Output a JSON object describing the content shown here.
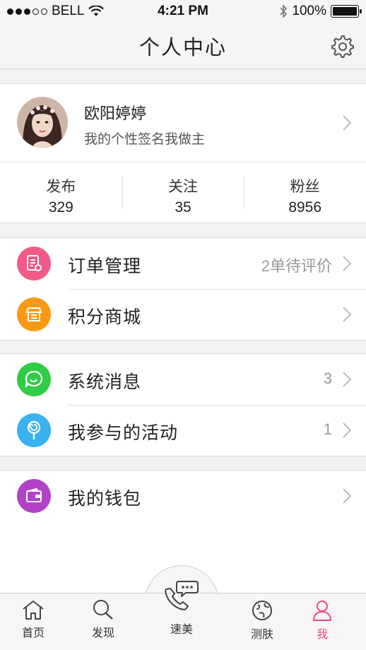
{
  "status_bar": {
    "carrier": "BELL",
    "time": "4:21 PM",
    "battery": "100%",
    "battery_level": 1.0,
    "signal_bars": 3
  },
  "header": {
    "title": "个人中心",
    "settings_icon": "gear-icon"
  },
  "profile": {
    "name": "欧阳婷婷",
    "signature": "我的个性签名我做主",
    "stats": [
      {
        "label": "发布",
        "value": "329"
      },
      {
        "label": "关注",
        "value": "35"
      },
      {
        "label": "粉丝",
        "value": "8956"
      }
    ]
  },
  "menu": {
    "orders": {
      "label": "订单管理",
      "extra": "2单待评价",
      "icon": "order-list-icon",
      "color": "#f25a86"
    },
    "points_mall": {
      "label": "积分商城",
      "icon": "store-icon",
      "color": "#fb9a12"
    },
    "messages": {
      "label": "系统消息",
      "extra": "3",
      "icon": "chat-bubble-icon",
      "color": "#2fcd45"
    },
    "activities": {
      "label": "我参与的活动",
      "extra": "1",
      "icon": "lollipop-icon",
      "color": "#39b2ef"
    },
    "wallet": {
      "label": "我的钱包",
      "icon": "wallet-icon",
      "color": "#b242c8"
    }
  },
  "tabbar": {
    "items": [
      {
        "label": "首页",
        "icon": "home-icon"
      },
      {
        "label": "发现",
        "icon": "search-icon"
      },
      {
        "label": "速美",
        "icon": "phone-chat-icon"
      },
      {
        "label": "测肤",
        "icon": "skin-test-icon"
      },
      {
        "label": "我",
        "icon": "user-icon",
        "active": true
      }
    ],
    "active_color": "#e84a7f"
  }
}
